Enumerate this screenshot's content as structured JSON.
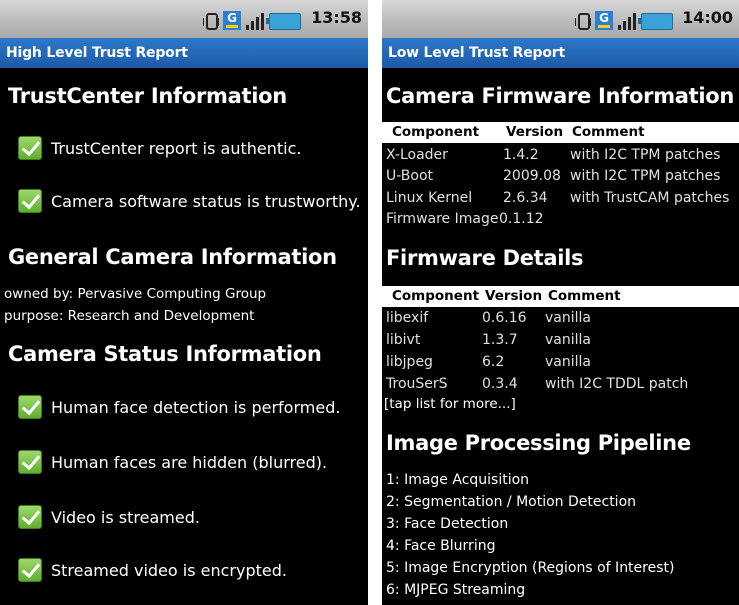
{
  "left": {
    "time": "13:58",
    "title": "High Level Trust Report",
    "trustcenter_heading": "TrustCenter Information",
    "trustcenter_items": [
      "TrustCenter report is authentic.",
      "Camera software status is trustworthy."
    ],
    "general_heading": "General Camera Information",
    "owned_by": "owned by: Pervasive Computing Group",
    "purpose": "purpose: Research and Development",
    "status_heading": "Camera Status Information",
    "status_items": [
      "Human face detection is performed.",
      "Human faces are hidden (blurred).",
      "Video is streamed.",
      "Streamed video is encrypted."
    ]
  },
  "right": {
    "time": "14:00",
    "title": "Low Level Trust Report",
    "firmware_info_heading": "Camera Firmware Information",
    "firmware_info_headers": [
      "Component",
      "Version",
      "Comment"
    ],
    "firmware_info_rows": [
      [
        "X-Loader",
        "1.4.2",
        "with I2C TPM patches"
      ],
      [
        "U-Boot",
        "2009.08",
        "with I2C TPM patches"
      ],
      [
        "Linux Kernel",
        "2.6.34",
        "with TrustCAM patches"
      ],
      [
        "Firmware Image",
        "0.1.12",
        ""
      ]
    ],
    "firmware_details_heading": "Firmware Details",
    "firmware_details_headers": [
      "Component",
      "Version",
      "Comment"
    ],
    "firmware_details_rows": [
      [
        "libexif",
        "0.6.16",
        "vanilla"
      ],
      [
        "libivt",
        "1.3.7",
        "vanilla"
      ],
      [
        "libjpeg",
        "6.2",
        "vanilla"
      ],
      [
        "TrouSerS",
        "0.3.4",
        "with I2C TDDL patch"
      ]
    ],
    "more_link": "[tap list for more...]",
    "pipeline_heading": "Image Processing Pipeline",
    "pipeline_items": [
      "1: Image Acquisition",
      "2: Segmentation / Motion Detection",
      "3: Face Detection",
      "4: Face Blurring",
      "5: Image Encryption (Regions of Interest)",
      "6: MJPEG Streaming"
    ]
  },
  "icons": {
    "vibrate": "vibrate-icon",
    "network": "g-network-icon",
    "signal": "signal-icon",
    "battery": "battery-icon",
    "check": "checkbox-icon"
  },
  "colors": {
    "titlebar": "#1f62b0",
    "statusbar": "#bdbdbd",
    "check": "#7cc44a"
  }
}
